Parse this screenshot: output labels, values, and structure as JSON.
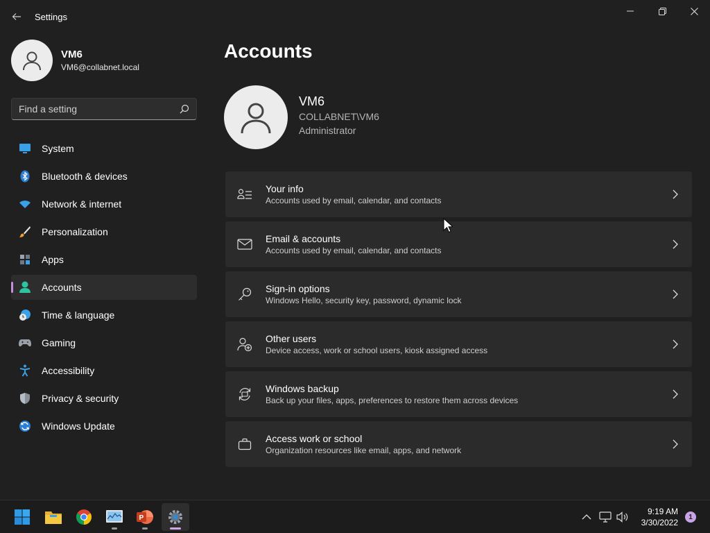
{
  "window": {
    "title": "Settings"
  },
  "profile": {
    "name": "VM6",
    "email": "VM6@collabnet.local"
  },
  "search": {
    "placeholder": "Find a setting"
  },
  "nav": {
    "items": [
      {
        "label": "System",
        "icon": "system-icon",
        "active": false
      },
      {
        "label": "Bluetooth & devices",
        "icon": "bluetooth-icon",
        "active": false
      },
      {
        "label": "Network & internet",
        "icon": "wifi-icon",
        "active": false
      },
      {
        "label": "Personalization",
        "icon": "brush-icon",
        "active": false
      },
      {
        "label": "Apps",
        "icon": "apps-icon",
        "active": false
      },
      {
        "label": "Accounts",
        "icon": "person-icon",
        "active": true
      },
      {
        "label": "Time & language",
        "icon": "globe-clock-icon",
        "active": false
      },
      {
        "label": "Gaming",
        "icon": "gamepad-icon",
        "active": false
      },
      {
        "label": "Accessibility",
        "icon": "accessibility-icon",
        "active": false
      },
      {
        "label": "Privacy & security",
        "icon": "shield-icon",
        "active": false
      },
      {
        "label": "Windows Update",
        "icon": "update-icon",
        "active": false
      }
    ]
  },
  "main": {
    "title": "Accounts",
    "user": {
      "name": "VM6",
      "domain": "COLLABNET\\VM6",
      "role": "Administrator"
    },
    "options": [
      {
        "title": "Your info",
        "desc": "Accounts used by email, calendar, and contacts",
        "icon": "person-card-icon"
      },
      {
        "title": "Email & accounts",
        "desc": "Accounts used by email, calendar, and contacts",
        "icon": "mail-icon"
      },
      {
        "title": "Sign-in options",
        "desc": "Windows Hello, security key, password, dynamic lock",
        "icon": "key-icon"
      },
      {
        "title": "Other users",
        "desc": "Device access, work or school users, kiosk assigned access",
        "icon": "add-person-icon"
      },
      {
        "title": "Windows backup",
        "desc": "Back up your files, apps, preferences to restore them across devices",
        "icon": "backup-icon"
      },
      {
        "title": "Access work or school",
        "desc": "Organization resources like email, apps, and network",
        "icon": "briefcase-icon"
      }
    ]
  },
  "taskbar": {
    "apps": [
      "start-icon",
      "file-explorer-icon",
      "chrome-icon",
      "task-manager-icon",
      "powerpoint-icon",
      "settings-app-icon"
    ],
    "time": "9:19 AM",
    "date": "3/30/2022",
    "notification_count": "1"
  },
  "colors": {
    "accent": "#c48fdc",
    "background": "#202020",
    "card": "#2b2b2b"
  }
}
